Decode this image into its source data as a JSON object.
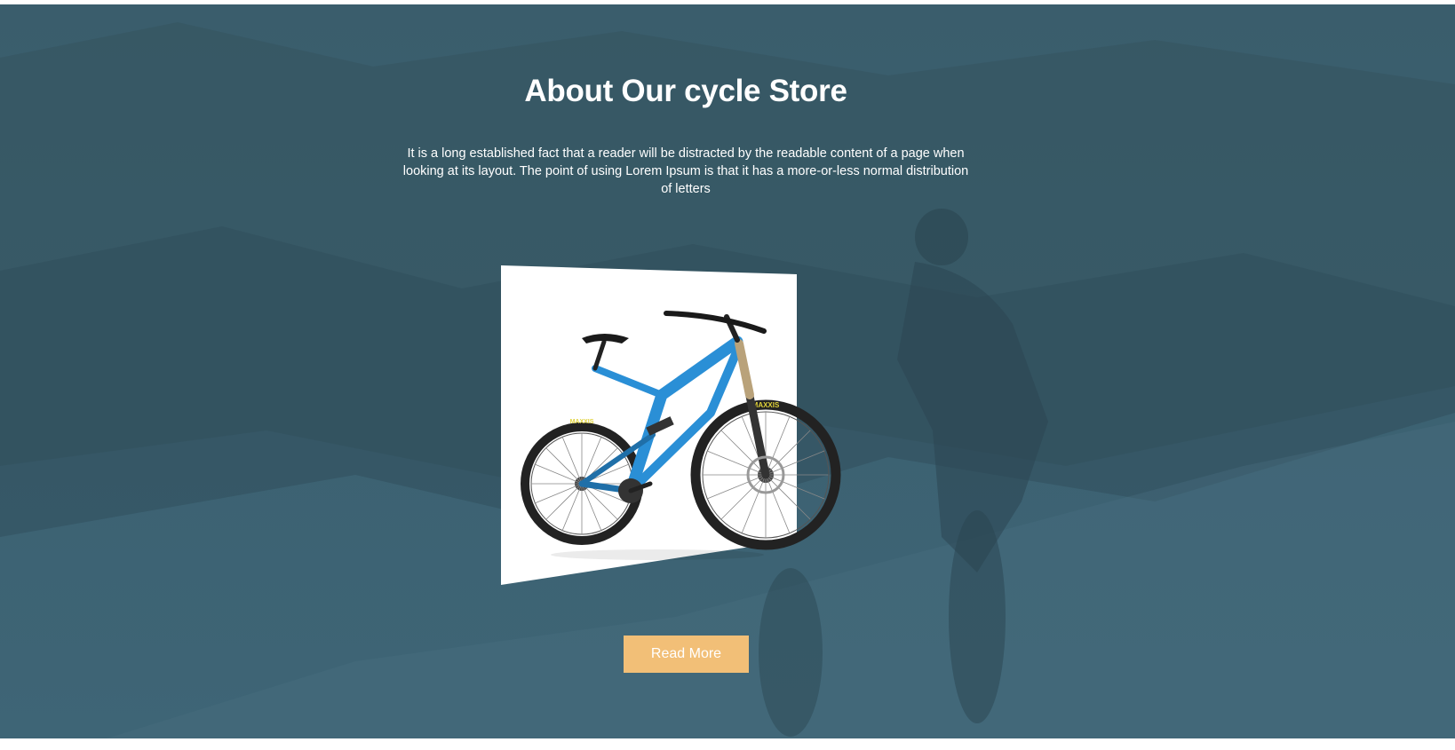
{
  "about": {
    "title": "About Our cycle Store",
    "description": "It is a long established fact that a reader will be distracted by the readable content of a page when looking at its layout. The point of using Lorem Ipsum is that it has a more-or-less normal distribution of letters",
    "read_more_label": "Read More"
  },
  "bike": {
    "tire_brand": "MAXXIS"
  },
  "colors": {
    "background_overlay": "#3b5f6e",
    "button": "#f2bf77",
    "bike_frame": "#2a8fd6",
    "text": "#ffffff"
  }
}
